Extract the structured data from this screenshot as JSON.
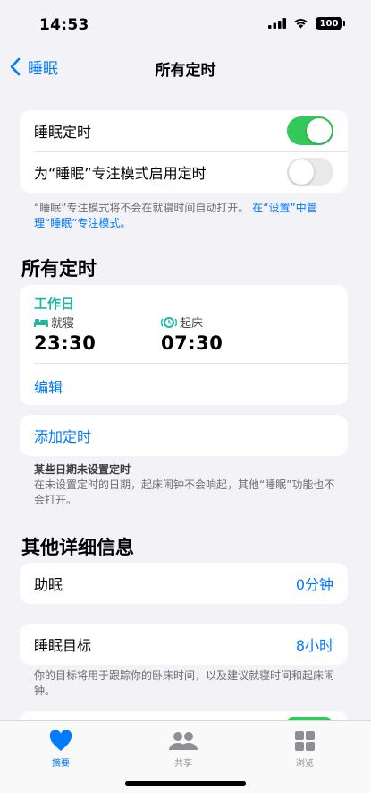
{
  "status_bar": {
    "time": "14:53",
    "battery": "100"
  },
  "nav": {
    "back_label": "睡眠",
    "title": "所有定时"
  },
  "sleep_schedule": {
    "label": "睡眠定时",
    "enabled": true,
    "focus_label": "为“睡眠”专注模式启用定时",
    "focus_enabled": false
  },
  "focus_note": {
    "text": "“睡眠”专注模式将不会在就寝时间自动打开。",
    "link": "在“设置”中管理“睡眠”专注模式。"
  },
  "all_schedules": {
    "title": "所有定时",
    "schedule": {
      "name": "工作日",
      "bedtime_label": "就寝",
      "bedtime": "23:30",
      "wake_label": "起床",
      "wake": "07:30",
      "edit_label": "编辑"
    },
    "add_label": "添加定时",
    "note_title": "某些日期未设置定时",
    "note_text": "在未设置定时的日期，起床闹钟不会响起，其他“睡眠”功能也不会打开。"
  },
  "other_details": {
    "title": "其他详细信息",
    "wind_down_label": "助眠",
    "wind_down_value": "0分钟",
    "sleep_goal_label": "睡眠目标",
    "sleep_goal_value": "8小时",
    "goal_note": "你的目标将用于跟踪你的卧床时间，以及建议就寝时间和起床闹钟。"
  },
  "tabs": [
    {
      "label": "摘要",
      "icon": "heart-icon",
      "active": true
    },
    {
      "label": "共享",
      "icon": "people-icon",
      "active": false
    },
    {
      "label": "浏览",
      "icon": "grid-icon",
      "active": false
    }
  ],
  "colors": {
    "accent": "#007aff",
    "toggle_on": "#34c759",
    "schedule": "#1fb8a5"
  }
}
